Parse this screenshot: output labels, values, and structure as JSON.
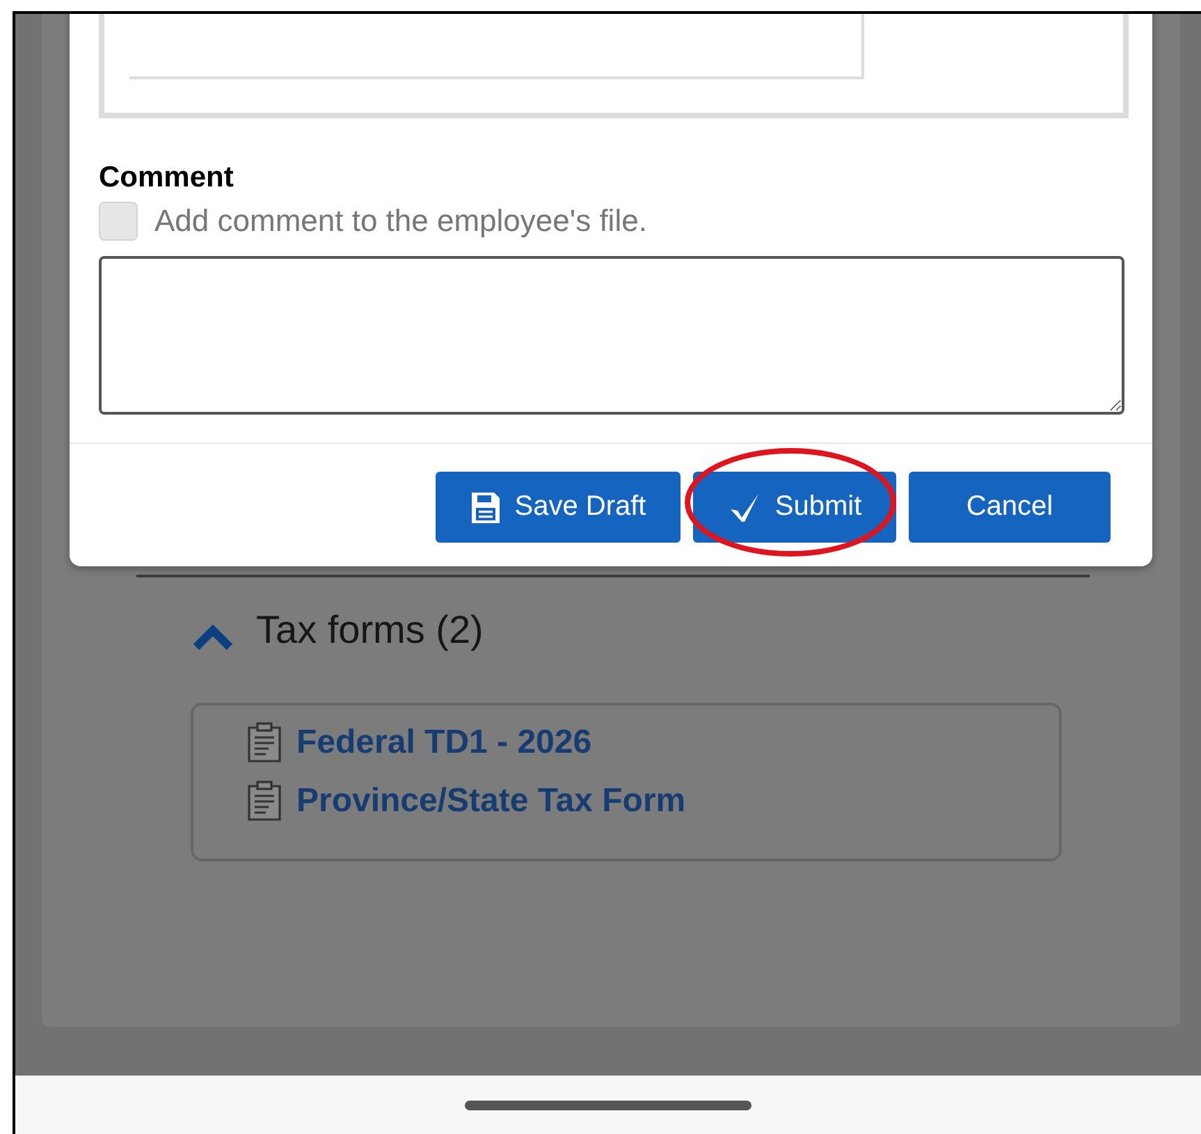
{
  "dialog": {
    "comment": {
      "label": "Comment",
      "checkbox_label": "Add comment to the employee's file.",
      "checked": false
    },
    "buttons": [
      {
        "label": "Save Draft",
        "kind": "save",
        "highlighted": false
      },
      {
        "label": "Submit",
        "kind": "submit",
        "highlighted": true
      },
      {
        "label": "Cancel",
        "kind": "plain",
        "highlighted": false
      }
    ]
  },
  "background": {
    "section": {
      "title": "Tax forms (2)",
      "expanded": true,
      "items": [
        "Federal TD1 - 2026",
        "Province/State Tax Form"
      ]
    }
  }
}
